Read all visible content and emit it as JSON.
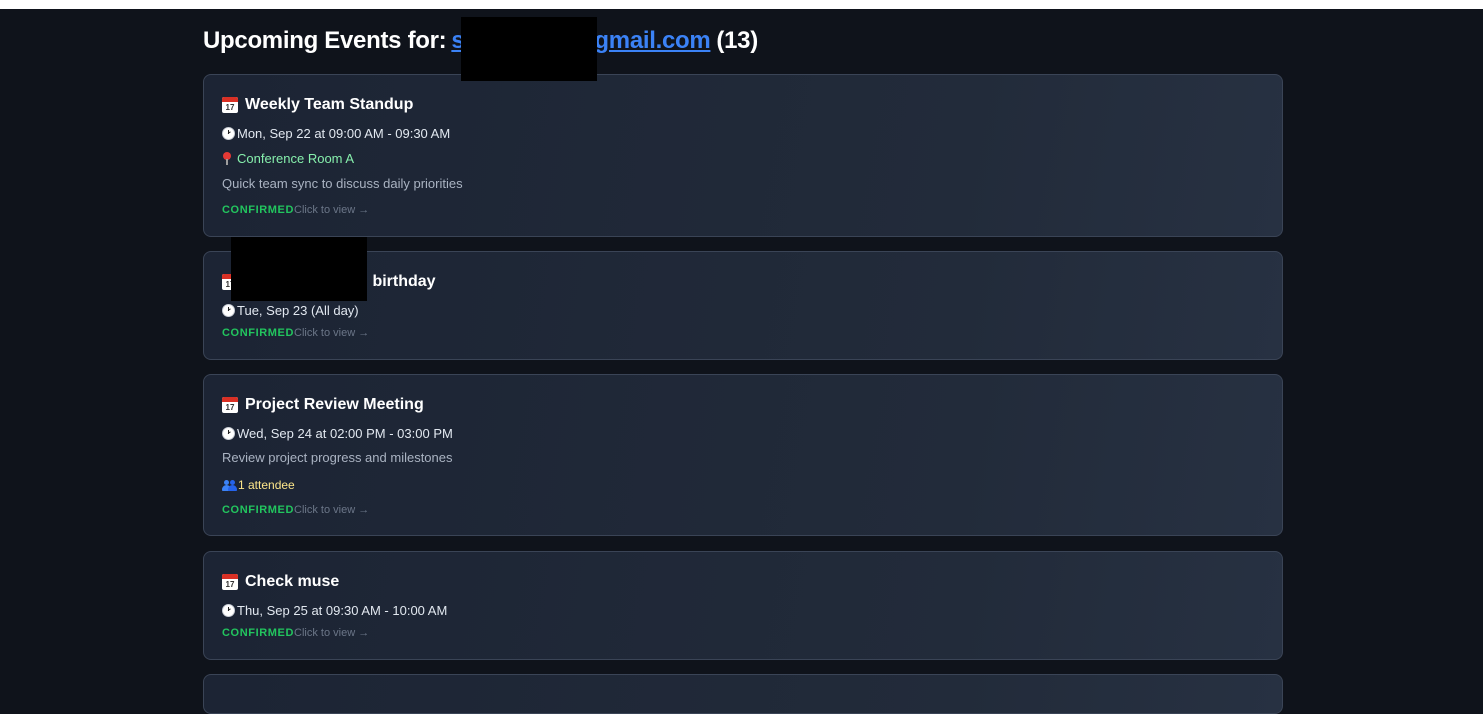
{
  "header": {
    "prefix": "Upcoming Events for:",
    "email_visible": "s",
    "email_suffix": "gmail.com",
    "count": "(13)"
  },
  "events": [
    {
      "title": "Weekly Team Standup",
      "time": "Mon, Sep 22 at 09:00 AM - 09:30 AM",
      "location": "Conference Room A",
      "description": "Quick team sync to discuss daily priorities",
      "status": "CONFIRMED",
      "view": "Click to view →"
    },
    {
      "title_suffix": " birthday",
      "time": "Tue, Sep 23 (All day)",
      "status": "CONFIRMED",
      "view": "Click to view →"
    },
    {
      "title": "Project Review Meeting",
      "time": "Wed, Sep 24 at 02:00 PM - 03:00 PM",
      "description": "Review project progress and milestones",
      "attendees": "1 attendee",
      "status": "CONFIRMED",
      "view": "Click to view →"
    },
    {
      "title": "Check muse",
      "time": "Thu, Sep 25 at 09:30 AM - 10:00 AM",
      "status": "CONFIRMED",
      "view": "Click to view →"
    }
  ],
  "icons": [
    "calendar-icon",
    "clock-icon",
    "map-pin-icon",
    "people-icon"
  ],
  "colors": {
    "background": "#0f131b",
    "card": "#1e2636",
    "link": "#3b82f6",
    "location": "#86efac",
    "attendees": "#fde68a",
    "status": "#22c55e"
  }
}
